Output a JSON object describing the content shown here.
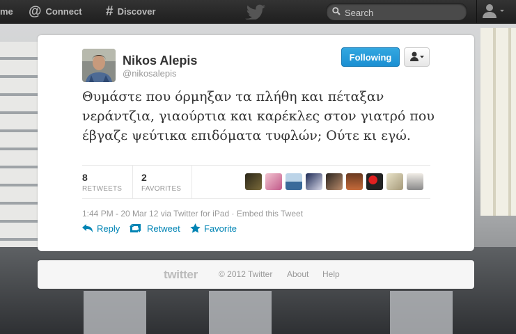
{
  "topbar": {
    "home_label": "me",
    "connect_label": "Connect",
    "discover_label": "Discover",
    "search_placeholder": "Search"
  },
  "tweet": {
    "author": {
      "fullname": "Nikos Alepis",
      "username": "@nikosalepis"
    },
    "follow_label": "Following",
    "text": "Θυμάστε που όρμηξαν τα πλήθη και πέταξαν νεράντζια, γιαούρτια και καρέκλες στον γιατρό που έβγαζε ψεύτικα επιδόματα τυφλών; Ούτε κι εγώ.",
    "stats": {
      "retweets_count": "8",
      "retweets_label": "RETWEETS",
      "favorites_count": "2",
      "favorites_label": "FAVORITES"
    },
    "meta": "1:44 PM - 20 Mar 12 via Twitter for iPad · Embed this Tweet",
    "actions": {
      "reply": "Reply",
      "retweet": "Retweet",
      "favorite": "Favorite"
    }
  },
  "footer": {
    "logo": "twitter",
    "copyright": "© 2012 Twitter",
    "about": "About",
    "help": "Help"
  },
  "colors": {
    "accent": "#0084b4",
    "follow_button": "#1b8fd2",
    "topbar": "#262626"
  }
}
